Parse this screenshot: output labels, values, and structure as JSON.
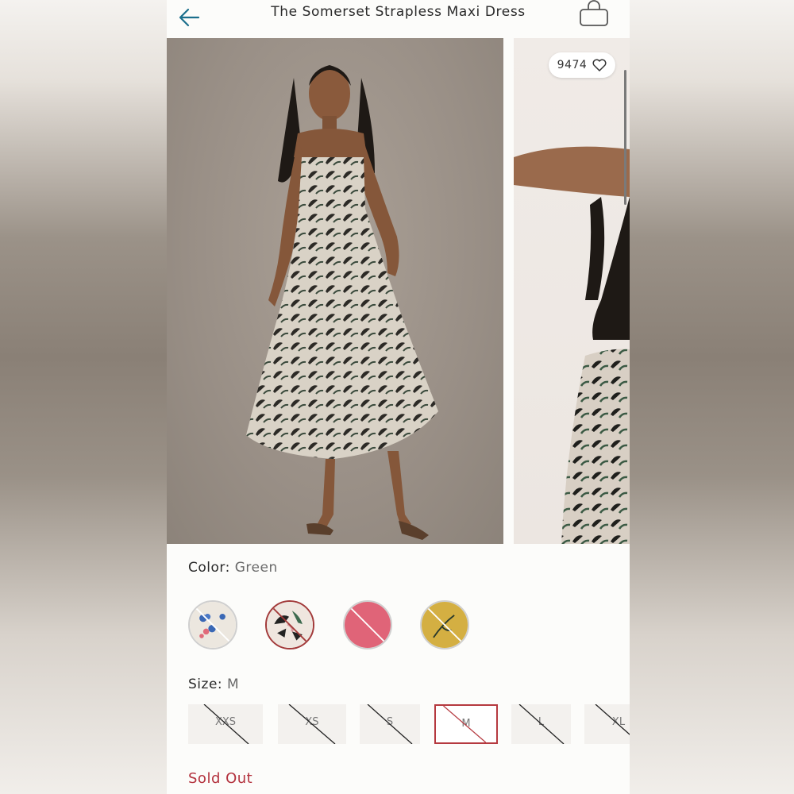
{
  "header": {
    "title": "The Somerset Strapless Maxi Dress",
    "back_icon": "back-arrow-icon",
    "bag_icon": "shopping-bag-icon"
  },
  "gallery": {
    "like_count": "9474",
    "like_icon": "heart-icon"
  },
  "color": {
    "label": "Color:",
    "value": "Green",
    "swatches": [
      {
        "name": "floral-white",
        "available": false
      },
      {
        "name": "green-print",
        "available": false,
        "selected": true
      },
      {
        "name": "pink",
        "available": false
      },
      {
        "name": "yellow-print",
        "available": false
      }
    ]
  },
  "size": {
    "label": "Size:",
    "value": "M",
    "options": [
      "XXS",
      "XS",
      "S",
      "M",
      "L",
      "XL"
    ]
  },
  "status": {
    "text": "Sold Out"
  },
  "colors": {
    "accent": "#b3313d",
    "back_arrow": "#1b6f8c"
  }
}
